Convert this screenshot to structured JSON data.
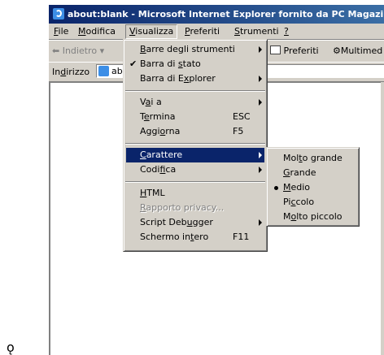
{
  "window": {
    "title": "about:blank - Microsoft Internet Explorer fornito da PC Magazine"
  },
  "menubar": [
    {
      "pre": "",
      "u": "F",
      "post": "ile"
    },
    {
      "pre": "",
      "u": "M",
      "post": "odifica"
    },
    {
      "pre": "",
      "u": "V",
      "post": "isualizza"
    },
    {
      "pre": "",
      "u": "P",
      "post": "referiti"
    },
    {
      "pre": "",
      "u": "S",
      "post": "trumenti"
    },
    {
      "pre": "",
      "u": "?",
      "post": ""
    }
  ],
  "toolbar": {
    "back_label": "Indietro",
    "favorites_label": "Preferiti",
    "media_label": "Multimed"
  },
  "address": {
    "label_pre": "In",
    "label_u": "d",
    "label_post": "irizzo",
    "value": "abc"
  },
  "view_menu": {
    "items": [
      {
        "pre": "",
        "u": "B",
        "post": "arre degli strumenti",
        "submenu": true
      },
      {
        "pre": "Barra di ",
        "u": "s",
        "post": "tato",
        "checked": true
      },
      {
        "pre": "Barra di E",
        "u": "x",
        "post": "plorer",
        "submenu": true
      },
      {
        "pre": "V",
        "u": "a",
        "post": "i a",
        "submenu": true
      },
      {
        "pre": "T",
        "u": "e",
        "post": "rmina",
        "shortcut": "ESC"
      },
      {
        "pre": "Aggi",
        "u": "o",
        "post": "rna",
        "shortcut": "F5"
      },
      {
        "pre": "",
        "u": "C",
        "post": "arattere",
        "submenu": true,
        "highlighted": true
      },
      {
        "pre": "Codi",
        "u": "f",
        "post": "ica",
        "submenu": true
      },
      {
        "pre": "",
        "u": "H",
        "post": "TML"
      },
      {
        "pre": "",
        "u": "R",
        "post": "apporto privacy...",
        "disabled": true
      },
      {
        "pre": "Script Deb",
        "u": "u",
        "post": "gger",
        "submenu": true
      },
      {
        "pre": "Schermo in",
        "u": "t",
        "post": "ero",
        "shortcut": "F11"
      }
    ]
  },
  "font_submenu": {
    "items": [
      {
        "pre": "Mol",
        "u": "t",
        "post": "o grande"
      },
      {
        "pre": "",
        "u": "G",
        "post": "rande"
      },
      {
        "pre": "",
        "u": "M",
        "post": "edio",
        "selected": true
      },
      {
        "pre": "Pi",
        "u": "c",
        "post": "colo"
      },
      {
        "pre": "M",
        "u": "o",
        "post": "lto piccolo"
      }
    ]
  },
  "stray_char": "ǫ"
}
